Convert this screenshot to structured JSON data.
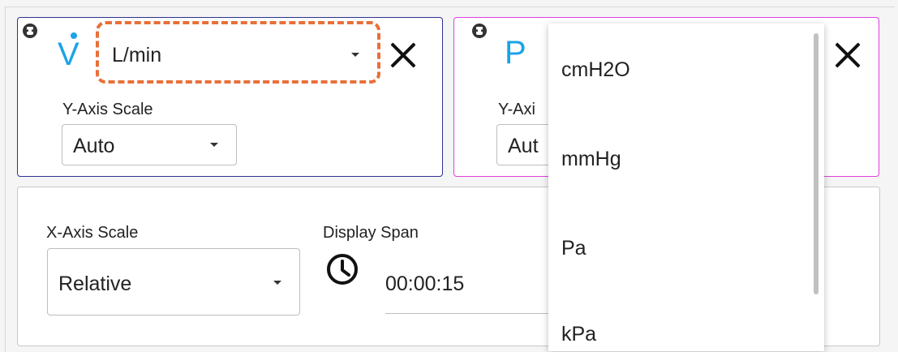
{
  "flow_card": {
    "symbol": "V",
    "unit_select": {
      "value": "L/min"
    },
    "y_axis_scale": {
      "label": "Y-Axis Scale",
      "value": "Auto"
    },
    "accent_color": "#2e3192"
  },
  "pressure_card": {
    "symbol": "P",
    "y_axis_scale": {
      "label": "Y-Axi",
      "value": "Aut"
    },
    "accent_color": "#e040e0"
  },
  "bottom_panel": {
    "x_axis_scale": {
      "label": "X-Axis Scale",
      "value": "Relative"
    },
    "display_span": {
      "label": "Display Span",
      "value": "00:00:15"
    }
  },
  "unit_dropdown": {
    "options": [
      "cmH2O",
      "mmHg",
      "Pa",
      "kPa"
    ]
  },
  "icons": {
    "pin": "pin-icon",
    "close": "close-icon",
    "clock": "clock-icon",
    "caret": "chevron-down-icon"
  },
  "colors": {
    "symbol": "#1aa3e8",
    "highlight": "#e8703a"
  }
}
